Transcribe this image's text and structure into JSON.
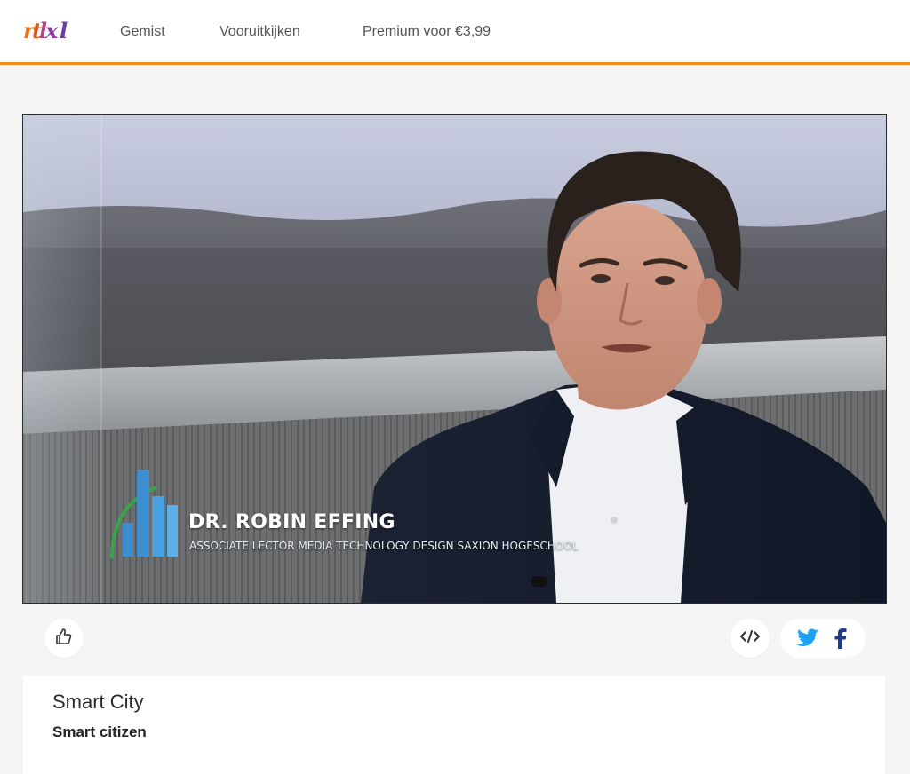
{
  "header": {
    "logo_text": "rtlxl",
    "nav": [
      {
        "label": "Gemist"
      },
      {
        "label": "Vooruitkijken"
      },
      {
        "label": "Premium voor €3,99"
      }
    ],
    "accent_color": "#f08a1c"
  },
  "video": {
    "lower_third": {
      "name": "DR. ROBIN EFFING",
      "title": "ASSOCIATE LECTOR MEDIA TECHNOLOGY DESIGN SAXION HOGESCHOOL"
    }
  },
  "actions": {
    "like_icon": "thumbs-up-icon",
    "embed_icon": "code-icon",
    "share": [
      {
        "icon": "twitter-icon",
        "color": "#1da1f2"
      },
      {
        "icon": "facebook-icon",
        "color": "#1e3a8a"
      }
    ]
  },
  "program": {
    "title": "Smart City",
    "episode": "Smart citizen"
  }
}
